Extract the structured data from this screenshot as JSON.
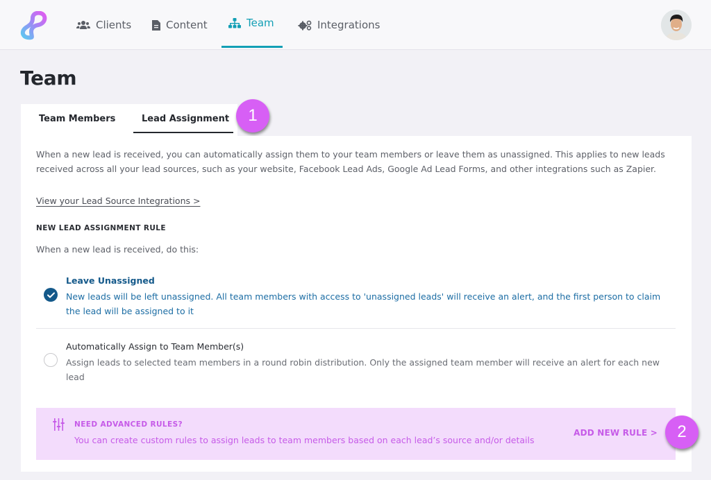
{
  "nav": {
    "logo": "app-logo",
    "items": [
      {
        "label": "Clients",
        "icon": "users-icon",
        "active": false
      },
      {
        "label": "Content",
        "icon": "document-icon",
        "active": false
      },
      {
        "label": "Team",
        "icon": "org-chart-icon",
        "active": true
      },
      {
        "label": "Integrations",
        "icon": "gears-icon",
        "active": false
      }
    ],
    "avatar": "user-avatar"
  },
  "page": {
    "title": "Team"
  },
  "tabs": [
    {
      "label": "Team Members",
      "active": false
    },
    {
      "label": "Lead Assignment",
      "active": true
    }
  ],
  "annotations": {
    "badge1": "1",
    "badge2": "2",
    "badge_color": "#d75ff5"
  },
  "content": {
    "description": "When a new lead is received, you can automatically assign them to your team members or leave them as unassigned. This applies to new leads received across all your lead sources, such as your website, Facebook Lead Ads, Google Ad Lead Forms, and other integrations such as Zapier.",
    "integrations_link": "View your Lead Source Integrations >",
    "rule_heading": "NEW LEAD ASSIGNMENT RULE",
    "rule_subheading": "When a new lead is received, do this:",
    "options": [
      {
        "title": "Leave Unassigned",
        "description": "New leads will be left unassigned. All team members with access to 'unassigned leads' will receive an alert, and the first person to claim the lead will be assigned to it",
        "selected": true
      },
      {
        "title": "Automatically Assign to Team Member(s)",
        "description": "Assign leads to selected team members in a round robin distribution. Only the assigned team member will receive an alert for each new lead",
        "selected": false
      }
    ],
    "advanced": {
      "icon": "sliders-icon",
      "title": "NEED ADVANCED RULES?",
      "description": "You can create custom rules to assign leads to team members based on each lead’s source and/or details",
      "button": "ADD NEW RULE >"
    }
  },
  "colors": {
    "accent_teal": "#139fb5",
    "selected_blue": "#14598a",
    "advanced_bg": "#f3dcfc",
    "advanced_text": "#c65be8"
  }
}
